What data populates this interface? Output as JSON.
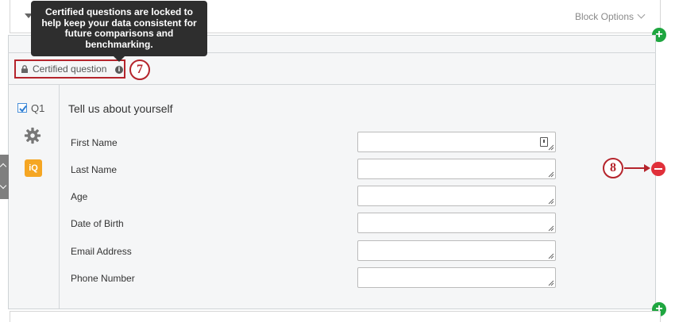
{
  "block": {
    "options_label": "Block Options"
  },
  "tooltip": {
    "text": "Certified questions are locked to help keep your data consistent for future comparisons and benchmarking."
  },
  "certified": {
    "label": "Certified question",
    "info": "i"
  },
  "callouts": {
    "seven": "7",
    "eight": "8"
  },
  "question": {
    "number": "Q1",
    "text": "Tell us about yourself",
    "iq_label": "iQ",
    "fields": [
      {
        "label": "First Name",
        "value": ""
      },
      {
        "label": "Last Name",
        "value": ""
      },
      {
        "label": "Age",
        "value": ""
      },
      {
        "label": "Date of Birth",
        "value": ""
      },
      {
        "label": "Email Address",
        "value": ""
      },
      {
        "label": "Phone Number",
        "value": ""
      }
    ]
  },
  "buttons": {
    "add": "+"
  },
  "colors": {
    "accent_red": "#b5242c",
    "add_green": "#1fa640",
    "remove_red": "#e0303a",
    "iq_orange": "#f5a623",
    "panel_bg": "#f5f6f7"
  }
}
